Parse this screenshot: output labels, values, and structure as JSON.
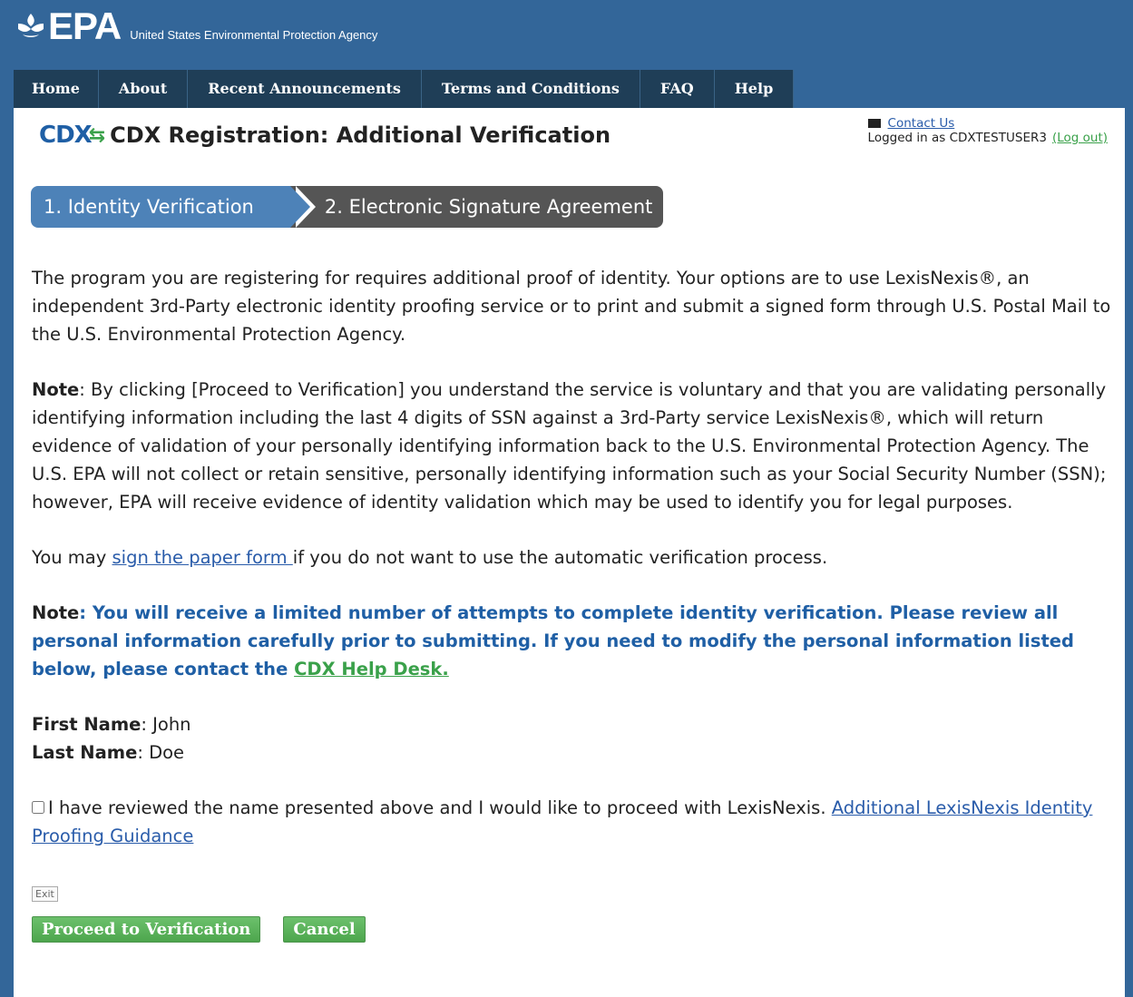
{
  "header": {
    "logo_text": "EPA",
    "agency": "United States Environmental Protection Agency"
  },
  "nav": {
    "items": [
      "Home",
      "About",
      "Recent Announcements",
      "Terms and Conditions",
      "FAQ",
      "Help"
    ]
  },
  "page": {
    "cdx_logo": "CDX",
    "title": "CDX Registration: Additional Verification",
    "contact_link": "Contact Us",
    "logged_in_text": "Logged in as CDXTESTUSER3",
    "logout_link": "(Log out)"
  },
  "steps": {
    "step1": "1. Identity Verification",
    "step2": "2. Electronic Signature Agreement"
  },
  "content": {
    "intro": "The program you are registering for requires additional proof of identity. Your options are to use LexisNexis®, an independent 3rd-Party electronic identity proofing service or to print and submit a signed form through U.S. Postal Mail to the U.S. Environmental Protection Agency.",
    "note1_label": "Note",
    "note1_text": ": By clicking [Proceed to Verification] you understand the service is voluntary and that you are validating personally identifying information including the last 4 digits of SSN against a 3rd-Party service LexisNexis®, which will return evidence of validation of your personally identifying information back to the U.S. Environmental Protection Agency. The U.S. EPA will not collect or retain sensitive, personally identifying information such as your Social Security Number (SSN); however, EPA will receive evidence of identity validation which may be used to identify you for legal purposes.",
    "paper_prefix": "You may ",
    "paper_link": "sign the paper form ",
    "paper_suffix": " if you do not want to use the automatic verification process.",
    "note2_label": "Note",
    "note2_text": ": You will receive a limited number of attempts to complete identity verification. Please review all personal information carefully prior to submitting. If you need to modify the personal information listed below, please contact the ",
    "help_desk_link": "CDX Help Desk.",
    "first_name_label": "First Name",
    "first_name_value": ": John",
    "last_name_label": "Last Name",
    "last_name_value": ": Doe",
    "checkbox_text": "I have reviewed the name presented above and I would like to proceed with LexisNexis. ",
    "guidance_link": "Additional LexisNexis Identity Proofing Guidance"
  },
  "buttons": {
    "exit": "Exit",
    "proceed": "Proceed to Verification",
    "cancel": "Cancel"
  }
}
